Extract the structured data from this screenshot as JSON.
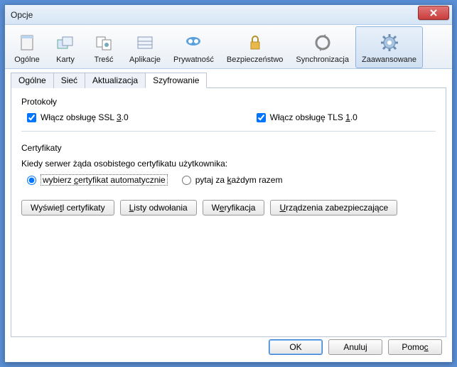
{
  "window": {
    "title": "Opcje"
  },
  "toolbar": {
    "items": [
      {
        "label": "Ogólne"
      },
      {
        "label": "Karty"
      },
      {
        "label": "Treść"
      },
      {
        "label": "Aplikacje"
      },
      {
        "label": "Prywatność"
      },
      {
        "label": "Bezpieczeństwo"
      },
      {
        "label": "Synchronizacja"
      },
      {
        "label": "Zaawansowane"
      }
    ]
  },
  "subtabs": {
    "items": [
      {
        "label": "Ogólne"
      },
      {
        "label": "Sieć"
      },
      {
        "label": "Aktualizacja"
      },
      {
        "label": "Szyfrowanie"
      }
    ]
  },
  "protocols": {
    "title": "Protokoły",
    "ssl_prefix": "Włącz obsługę SSL ",
    "ssl_underline": "3",
    "ssl_suffix": ".0",
    "tls_prefix": "Włącz obsługę TLS ",
    "tls_underline": "1",
    "tls_suffix": ".0"
  },
  "certs": {
    "title": "Certyfikaty",
    "desc": "Kiedy serwer żąda osobistego certyfikatu użytkownika:",
    "radio_auto_prefix": "wybierz ",
    "radio_auto_underline": "c",
    "radio_auto_suffix": "ertyfikat automatycznie",
    "radio_ask_prefix": "pytaj za ",
    "radio_ask_underline": "k",
    "radio_ask_suffix": "ażdym razem",
    "btn_view_prefix": "Wyświe",
    "btn_view_underline": "t",
    "btn_view_suffix": "l certyfikaty",
    "btn_crl_prefix": "",
    "btn_crl_underline": "L",
    "btn_crl_suffix": "isty odwołania",
    "btn_verify_prefix": "W",
    "btn_verify_underline": "e",
    "btn_verify_suffix": "ryfikacja",
    "btn_devices_prefix": "",
    "btn_devices_underline": "U",
    "btn_devices_suffix": "rządzenia zabezpieczające"
  },
  "footer": {
    "ok": "OK",
    "cancel": "Anuluj",
    "help_prefix": "Pomo",
    "help_underline": "c"
  }
}
